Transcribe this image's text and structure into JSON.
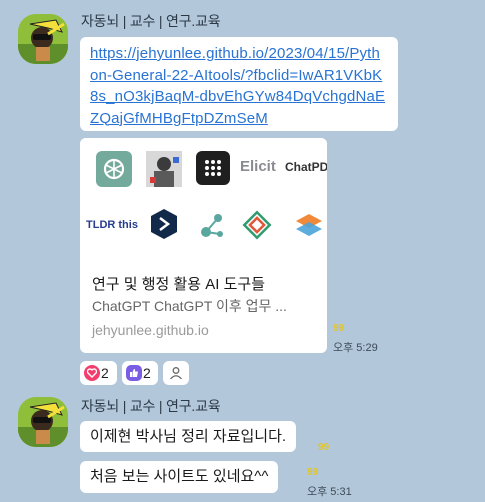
{
  "chat": {
    "group1": {
      "sender": "자동뇌 | 교수 | 연구.교육",
      "link_url": "https://jehyunlee.github.io/2023/04/15/Python-General-22-AItools/?fbclid=IwAR1VKbK8s_nO3kjBaqM-dbvEhGYw84DqVchgdNaEZQajGfMHBgFtpDZmSeM",
      "link_preview": {
        "tools": [
          "ChatGPT",
          "Elicit",
          "ChatPDF",
          "TLDR this"
        ],
        "title": "연구 및 행정 활용 AI 도구들",
        "description": "ChatGPT ChatGPT 이후 업무 ...",
        "domain": "jehyunlee.github.io"
      },
      "unread_count": "99",
      "time": "오후 5:29",
      "reactions": [
        {
          "icon": "heart-icon",
          "count": "2",
          "color": "#f23d6d"
        },
        {
          "icon": "thumbs-up-icon",
          "count": "2",
          "color": "#7b5ce5"
        }
      ]
    },
    "group2": {
      "sender": "자동뇌 | 교수 | 연구.교육",
      "messages": [
        {
          "text": "이제현 박사님 정리 자료입니다.",
          "unread_count": "99"
        },
        {
          "text": "처음 보는 사이트도 있네요^^",
          "unread_count": "99",
          "time": "오후 5:31"
        }
      ]
    }
  },
  "colors": {
    "background": "#b2c7da",
    "bubble": "#ffffff",
    "link": "#2873d3",
    "unread": "#e2c629"
  }
}
